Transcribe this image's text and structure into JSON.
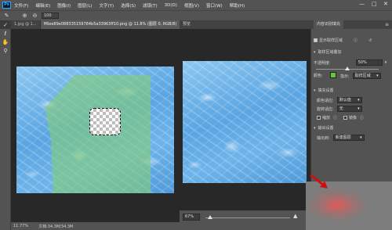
{
  "app": {
    "logo": "Ps"
  },
  "menubar": {
    "items": [
      "文件(F)",
      "编辑(E)",
      "图像(I)",
      "图层(L)",
      "文字(Y)",
      "选择(S)",
      "滤镜(T)",
      "3D(D)",
      "视图(V)",
      "窗口(W)",
      "帮助(H)"
    ],
    "window_controls": [
      "—",
      "□",
      "✕"
    ]
  },
  "options_bar": {
    "brush_size": "100"
  },
  "tabs": [
    {
      "label": "1.jpg @ 1...",
      "active": false
    },
    {
      "label": "ff6ee89e088335159784b5a33963ff10.png @ 11.8% (图层 0, RGB/8)",
      "active": true
    }
  ],
  "statusbar": {
    "zoom": "11.77%",
    "doc": "文档:34.3M/34.3M"
  },
  "preview": {
    "title": "预览",
    "zoom": "67%",
    "zoom_fraction": 0.06
  },
  "properties": {
    "title": "内容识别填充",
    "show_sample": "显示取样区域",
    "sample_overlay": {
      "heading": "取样区域叠加",
      "opacity_label": "不透明度:",
      "opacity_value": "50%",
      "color_label": "颜色:",
      "color_hex": "#63c83a",
      "indicates_label": "指示:",
      "indicates_value": "取样区域"
    },
    "fill_settings": {
      "heading": "填充设置",
      "color_adapt_label": "颜色适应:",
      "color_adapt_value": "默认值",
      "rotation_label": "旋转适应:",
      "rotation_value": "无",
      "scale_label": "缩放",
      "mirror_label": "镜像"
    },
    "output_settings": {
      "heading": "输出设置",
      "output_label": "输出到:",
      "output_value": "新建图层"
    }
  }
}
